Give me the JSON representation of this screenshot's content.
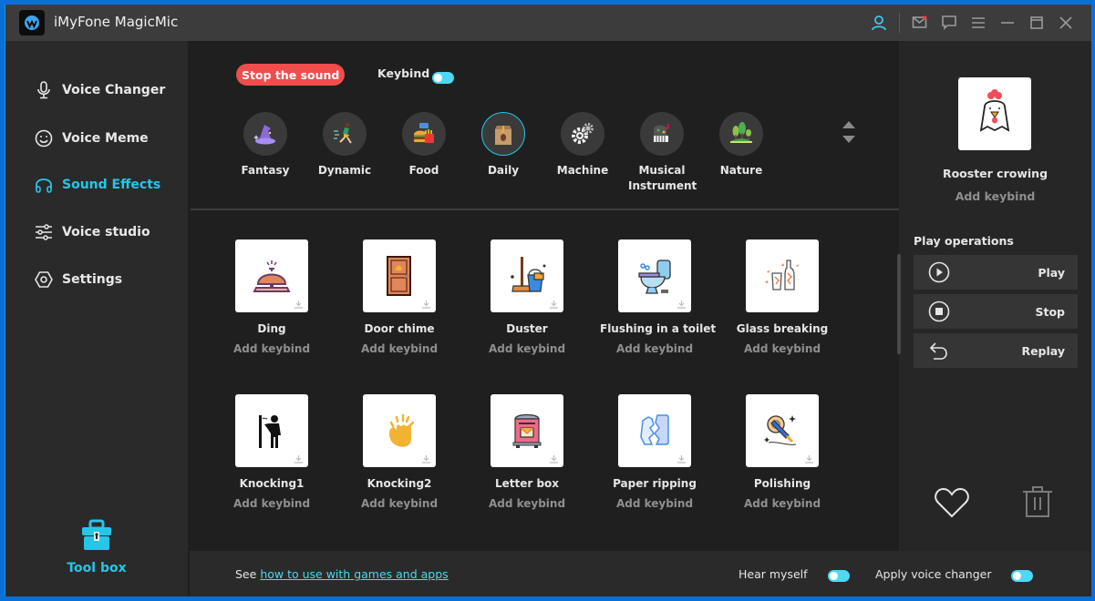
{
  "window": {
    "title": "iMyFone MagicMic",
    "titlebar_icons": [
      "user-icon",
      "mail-icon",
      "chat-icon",
      "menu-icon",
      "minimize-icon",
      "maximize-icon",
      "close-icon"
    ]
  },
  "sidebar": {
    "items": [
      {
        "label": "Voice Changer",
        "icon": "microphone-icon",
        "active": false
      },
      {
        "label": "Voice Meme",
        "icon": "smiley-icon",
        "active": false
      },
      {
        "label": "Sound Effects",
        "icon": "headphones-icon",
        "active": true
      },
      {
        "label": "Voice studio",
        "icon": "sliders-icon",
        "active": false
      },
      {
        "label": "Settings",
        "icon": "settings-hex-icon",
        "active": false
      }
    ],
    "toolbox_label": "Tool box"
  },
  "main": {
    "stop_label": "Stop the sound",
    "keybind_label": "Keybind",
    "keybind_on": true,
    "categories": [
      {
        "label": "Fantasy",
        "icon": "wizard-hat-icon"
      },
      {
        "label": "Dynamic",
        "icon": "runner-icon"
      },
      {
        "label": "Food",
        "icon": "burger-icon"
      },
      {
        "label": "Daily",
        "icon": "coffee-bag-icon",
        "active": true
      },
      {
        "label": "Machine",
        "icon": "gears-icon"
      },
      {
        "label": "Musical Instrument",
        "icon": "piano-icon"
      },
      {
        "label": "Nature",
        "icon": "trees-icon"
      }
    ],
    "sounds": [
      {
        "name": "Ding",
        "keybind": "Add keybind",
        "icon": "service-bell-icon"
      },
      {
        "name": "Door chime",
        "keybind": "Add keybind",
        "icon": "door-icon"
      },
      {
        "name": "Duster",
        "keybind": "Add keybind",
        "icon": "broom-bucket-icon"
      },
      {
        "name": "Flushing in a toilet",
        "keybind": "Add keybind",
        "icon": "toilet-icon"
      },
      {
        "name": "Glass breaking",
        "keybind": "Add keybind",
        "icon": "broken-glass-icon"
      },
      {
        "name": "Knocking1",
        "keybind": "Add keybind",
        "icon": "person-knocking-icon"
      },
      {
        "name": "Knocking2",
        "keybind": "Add keybind",
        "icon": "hand-knock-icon"
      },
      {
        "name": "Letter box",
        "keybind": "Add keybind",
        "icon": "mailbox-icon"
      },
      {
        "name": "Paper ripping",
        "keybind": "Add keybind",
        "icon": "torn-paper-icon"
      },
      {
        "name": "Polishing",
        "keybind": "Add keybind",
        "icon": "polisher-icon"
      }
    ]
  },
  "selected": {
    "name": "Rooster crowing",
    "keybind": "Add keybind",
    "icon": "rooster-icon"
  },
  "play_operations": {
    "title": "Play operations",
    "buttons": [
      {
        "label": "Play",
        "icon": "play-circle-icon"
      },
      {
        "label": "Stop",
        "icon": "stop-circle-icon"
      },
      {
        "label": "Replay",
        "icon": "replay-icon"
      }
    ]
  },
  "footer": {
    "see_prefix": "See",
    "link_text": "how to use with games and apps",
    "hear_myself": "Hear myself",
    "hear_myself_on": true,
    "apply_voice_changer": "Apply voice changer",
    "apply_voice_changer_on": true
  },
  "colors": {
    "accent": "#26c6e8",
    "stop_red": "#f04d4d",
    "background": "#1f1f1f",
    "sidebar": "#2a2a2a",
    "titlebar": "#3c3c3c"
  }
}
